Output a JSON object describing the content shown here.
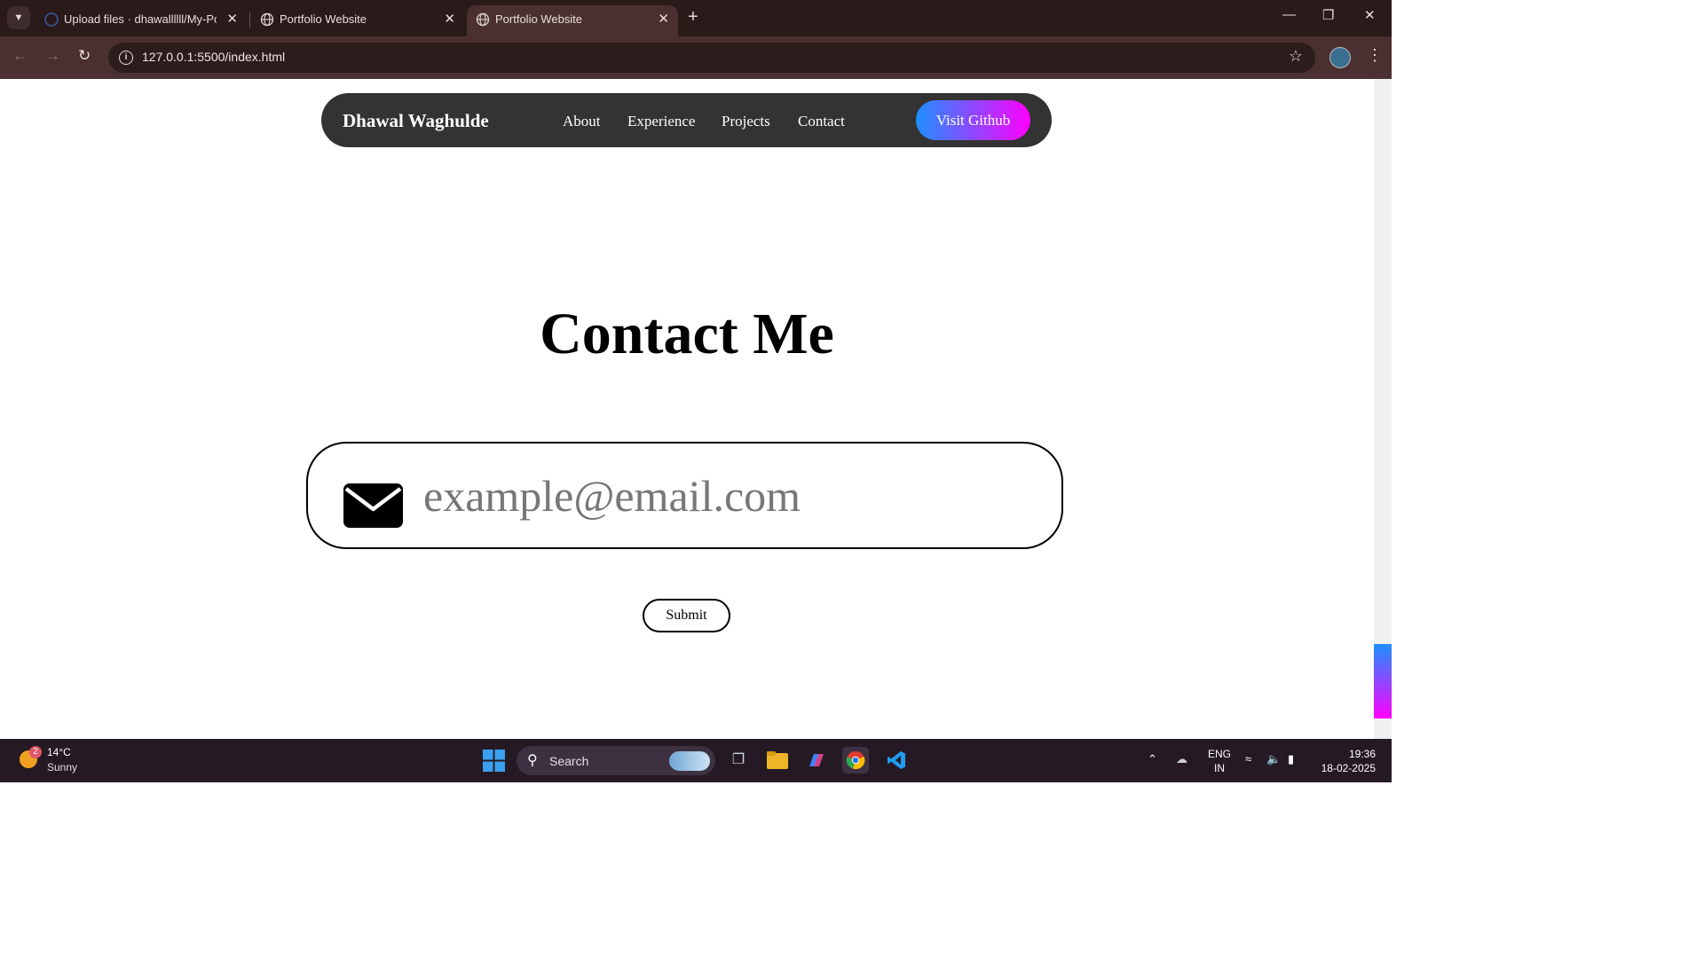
{
  "browser": {
    "tabs": [
      {
        "title": "Upload files · dhawallllll/My-Por",
        "active": false
      },
      {
        "title": "Portfolio Website",
        "active": false
      },
      {
        "title": "Portfolio Website",
        "active": true
      }
    ],
    "url": "127.0.0.1:5500/index.html"
  },
  "page": {
    "brand": "Dhawal Waghulde",
    "nav": [
      "About",
      "Experience",
      "Projects",
      "Contact"
    ],
    "github_button": "Visit Github",
    "heading": "Contact Me",
    "email_placeholder": "example@email.com",
    "submit_label": "Submit"
  },
  "taskbar": {
    "weather": {
      "temp": "14°C",
      "condition": "Sunny",
      "badge": "2"
    },
    "search_label": "Search",
    "lang": {
      "line1": "ENG",
      "line2": "IN"
    },
    "clock": {
      "time": "19:36",
      "date": "18-02-2025"
    }
  },
  "colors": {
    "navbar_bg": "#333333",
    "gradient_start": "#1e90ff",
    "gradient_end": "#ff00ff",
    "browser_frame": "#4a3030"
  }
}
